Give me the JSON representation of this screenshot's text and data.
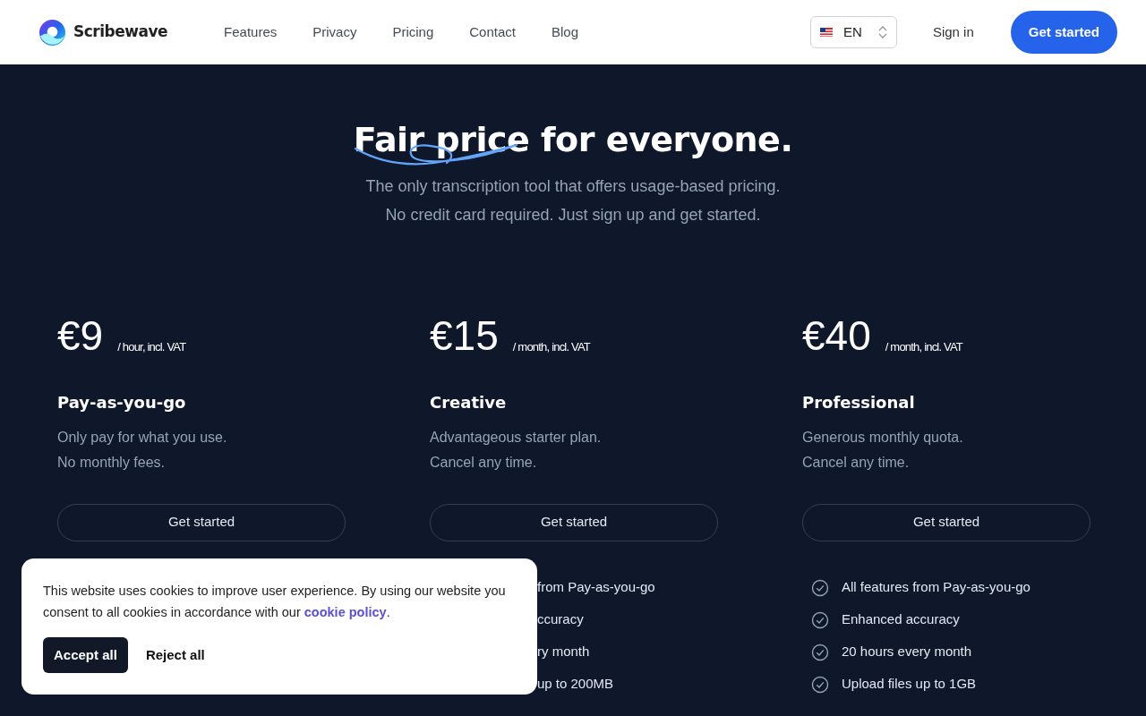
{
  "navbar": {
    "brand": "Scribewave",
    "links": [
      "Features",
      "Privacy",
      "Pricing",
      "Contact",
      "Blog"
    ],
    "language": "EN",
    "sign_in": "Sign in",
    "cta": "Get started"
  },
  "hero": {
    "title_marked": "Fair price",
    "title_rest": "for everyone.",
    "subtitle_lines": [
      "The only transcription tool that offers usage-based pricing.",
      "No credit card required. Just sign up and get started."
    ]
  },
  "plans": [
    {
      "price": "€9",
      "unit": "/ hour, incl. VAT",
      "name": "Pay-as-you-go",
      "description": [
        "Only pay for what you use.",
        "No monthly fees."
      ],
      "button": "Get started"
    },
    {
      "price": "€15",
      "unit": "/ month, incl. VAT",
      "name": "Creative",
      "description": [
        "Advantageous starter plan.",
        "Cancel any time."
      ],
      "button": "Get started",
      "features": [
        {
          "text": "from Pay-as-you-go",
          "covered": true
        },
        {
          "text": "ccuracy",
          "covered": true
        },
        {
          "text": "ry month",
          "covered": true
        },
        {
          "text": "up to 200MB",
          "covered": true
        }
      ]
    },
    {
      "price": "€40",
      "unit": "/ month, incl. VAT",
      "name": "Professional",
      "description": [
        "Generous monthly quota.",
        "Cancel any time."
      ],
      "button": "Get started",
      "features": [
        {
          "text": "All features from Pay-as-you-go",
          "covered": false
        },
        {
          "text": "Enhanced accuracy",
          "covered": false
        },
        {
          "text": "20 hours every month",
          "covered": false
        },
        {
          "text": "Upload files up to 1GB",
          "covered": false
        }
      ]
    }
  ],
  "cookie_banner": {
    "message": "This website uses cookies to improve user experience. By using our website you consent to all cookies in accordance with our ",
    "link": "cookie policy",
    "message_end": ".",
    "accept": "Accept all",
    "reject": "Reject all"
  }
}
